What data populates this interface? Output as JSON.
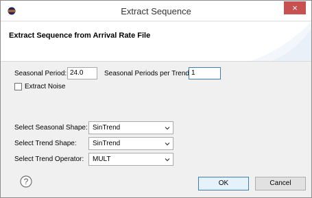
{
  "window": {
    "title": "Extract Sequence",
    "close_glyph": "×",
    "icon": "eclipse-icon"
  },
  "banner": {
    "title": "Extract Sequence from Arrival Rate File"
  },
  "form": {
    "seasonal_period_label": "Seasonal Period:",
    "seasonal_period_value": "24.0",
    "periods_per_trend_label": "Seasonal Periods per Trend:",
    "periods_per_trend_value": "1",
    "extract_noise_label": "Extract Noise",
    "extract_noise_checked": false,
    "seasonal_shape_label": "Select Seasonal Shape:",
    "seasonal_shape_value": "SinTrend",
    "trend_shape_label": "Select Trend Shape:",
    "trend_shape_value": "SinTrend",
    "trend_operator_label": "Select Trend Operator:",
    "trend_operator_value": "MULT"
  },
  "footer": {
    "help_icon": "help-icon",
    "ok_label": "OK",
    "cancel_label": "Cancel"
  }
}
